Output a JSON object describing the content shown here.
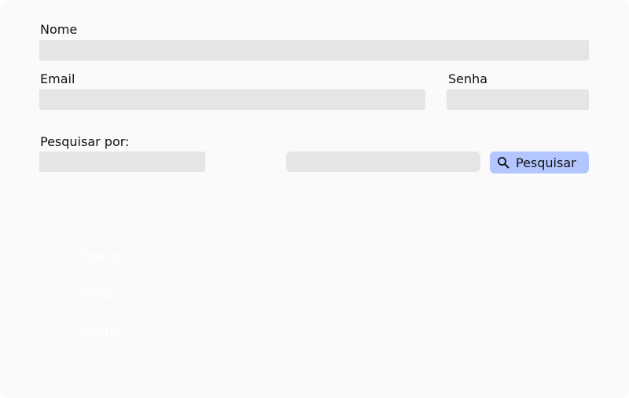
{
  "form": {
    "nome_label": "Nome",
    "email_label": "Email",
    "senha_label": "Senha",
    "pesquisar_por_label": "Pesquisar por:",
    "search_button_label": "Pesquisar",
    "search_icon": "search-icon"
  },
  "dropdown_options": [
    "Telefone",
    "Email",
    "Senha"
  ],
  "colors": {
    "background": "#fafafa",
    "field": "#e5e5e5",
    "button": "#b3c6ff"
  }
}
